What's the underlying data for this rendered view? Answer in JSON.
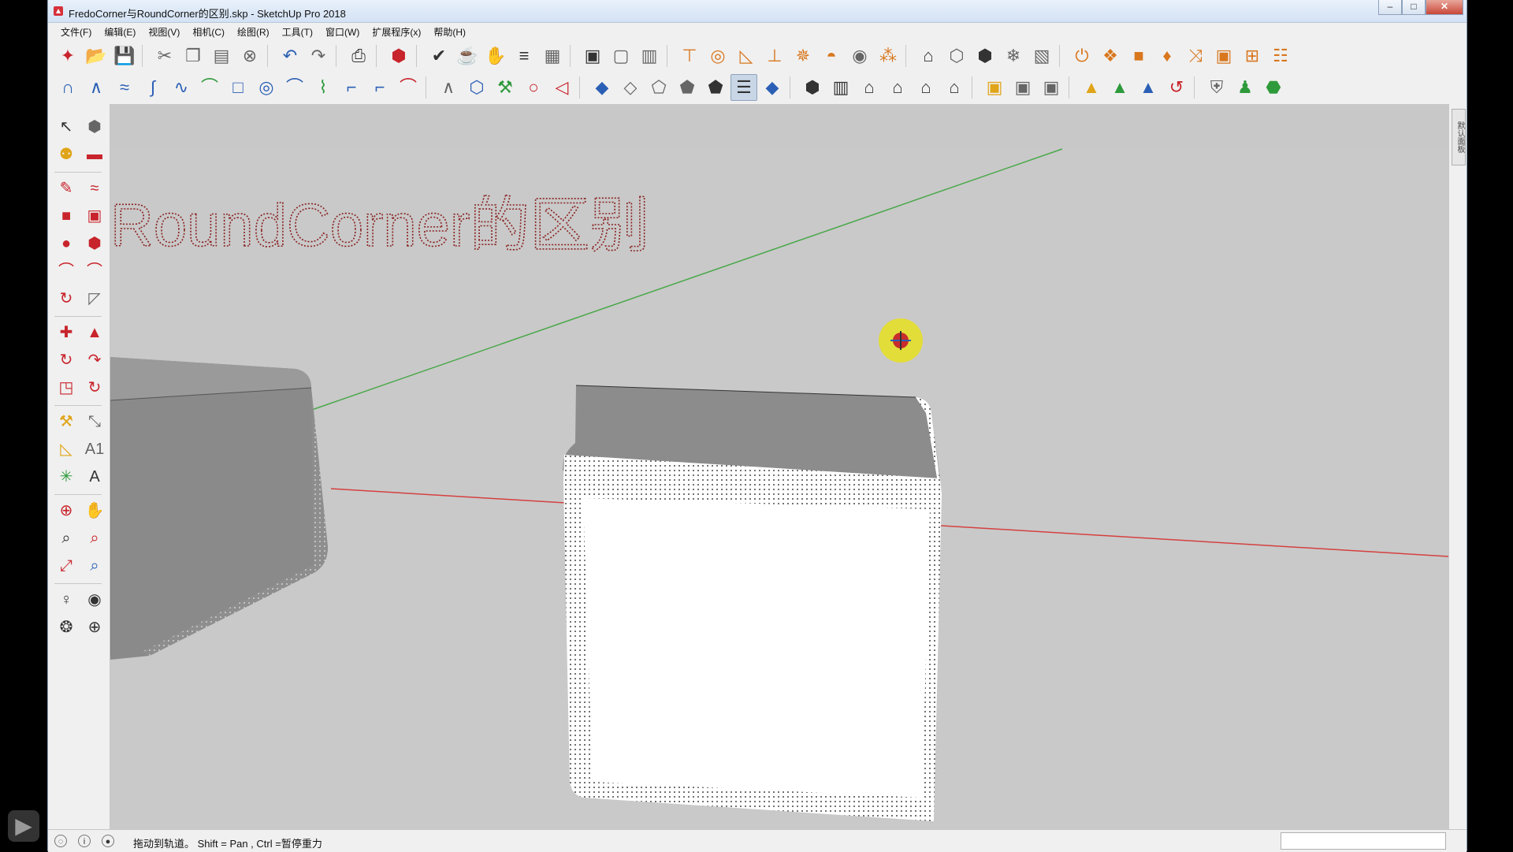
{
  "window": {
    "title": "FredoCorner与RoundCorner的区别.skp - SketchUp Pro 2018",
    "controls": {
      "minimize": "–",
      "maximize": "□",
      "close": "✕"
    }
  },
  "menu": [
    "文件(F)",
    "编辑(E)",
    "视图(V)",
    "相机(C)",
    "绘图(R)",
    "工具(T)",
    "窗口(W)",
    "扩展程序(x)",
    "帮助(H)"
  ],
  "toolbar_row1": [
    {
      "name": "new-model-icon",
      "glyph": "✦",
      "color": "red"
    },
    {
      "name": "open-folder-icon",
      "glyph": "📂",
      "color": "dark"
    },
    {
      "name": "save-icon",
      "glyph": "💾",
      "color": "blue"
    },
    {
      "sep": true
    },
    {
      "name": "cut-icon",
      "glyph": "✂",
      "color": "gray"
    },
    {
      "name": "copy-icon",
      "glyph": "❐",
      "color": "gray"
    },
    {
      "name": "paste-icon",
      "glyph": "▤",
      "color": "gray"
    },
    {
      "name": "erase-icon",
      "glyph": "⊗",
      "color": "gray"
    },
    {
      "sep": true
    },
    {
      "name": "undo-icon",
      "glyph": "↶",
      "color": "blue"
    },
    {
      "name": "redo-icon",
      "glyph": "↷",
      "color": "gray"
    },
    {
      "sep": true
    },
    {
      "name": "print-icon",
      "glyph": "⎙",
      "color": "dark"
    },
    {
      "sep": true
    },
    {
      "name": "model-info-icon",
      "glyph": "⬢",
      "color": "red"
    },
    {
      "sep": true
    },
    {
      "name": "validity-check-icon",
      "glyph": "✔",
      "color": "dark"
    },
    {
      "name": "teapot-icon",
      "glyph": "☕",
      "color": "dark"
    },
    {
      "name": "teapot-hand-icon",
      "glyph": "✋",
      "color": "dark"
    },
    {
      "name": "align-icon",
      "glyph": "≡",
      "color": "dark"
    },
    {
      "name": "layout-icon",
      "glyph": "▦",
      "color": "gray"
    },
    {
      "sep": true
    },
    {
      "name": "window-icon",
      "glyph": "▣",
      "color": "dark"
    },
    {
      "name": "window2-icon",
      "glyph": "▢",
      "color": "gray"
    },
    {
      "name": "window3-icon",
      "glyph": "▥",
      "color": "gray"
    },
    {
      "sep": true
    },
    {
      "name": "extension1-icon",
      "glyph": "⊤",
      "color": "orange"
    },
    {
      "name": "extension2-icon",
      "glyph": "◎",
      "color": "orange"
    },
    {
      "name": "extension3-icon",
      "glyph": "◺",
      "color": "orange"
    },
    {
      "name": "extension4-icon",
      "glyph": "⊥",
      "color": "orange"
    },
    {
      "name": "extension5-icon",
      "glyph": "✵",
      "color": "orange"
    },
    {
      "name": "extension6-icon",
      "glyph": "◓",
      "color": "orange"
    },
    {
      "name": "extension7-icon",
      "glyph": "◉",
      "color": "gray"
    },
    {
      "name": "extension8-icon",
      "glyph": "⁂",
      "color": "orange"
    },
    {
      "sep": true
    },
    {
      "name": "extension9-icon",
      "glyph": "⌂",
      "color": "dark"
    },
    {
      "name": "extension10-icon",
      "glyph": "⬡",
      "color": "gray"
    },
    {
      "name": "extension11-icon",
      "glyph": "⬢",
      "color": "dark"
    },
    {
      "name": "extension12-icon",
      "glyph": "❄",
      "color": "gray"
    },
    {
      "name": "extension13-icon",
      "glyph": "▧",
      "color": "gray"
    },
    {
      "sep": true
    },
    {
      "name": "power-icon",
      "glyph": "⏻",
      "color": "orange"
    },
    {
      "name": "extension14-icon",
      "glyph": "❖",
      "color": "orange"
    },
    {
      "name": "folder-orange-icon",
      "glyph": "■",
      "color": "orange"
    },
    {
      "name": "bin-icon",
      "glyph": "♦",
      "color": "orange"
    },
    {
      "name": "shuffle-icon",
      "glyph": "⤨",
      "color": "orange"
    },
    {
      "name": "frame-icon",
      "glyph": "▣",
      "color": "orange"
    },
    {
      "name": "add-frame-icon",
      "glyph": "⊞",
      "color": "orange"
    },
    {
      "name": "comment-icon",
      "glyph": "☷",
      "color": "orange"
    }
  ],
  "toolbar_row2": [
    {
      "name": "bezier-icon",
      "glyph": "∩",
      "color": "blue"
    },
    {
      "name": "polyline-icon",
      "glyph": "∧",
      "color": "blue"
    },
    {
      "name": "freehand-icon",
      "glyph": "≈",
      "color": "blue"
    },
    {
      "name": "spline-icon",
      "glyph": "∫",
      "color": "blue"
    },
    {
      "name": "curve-icon",
      "glyph": "∿",
      "color": "blue"
    },
    {
      "name": "arc-green-icon",
      "glyph": "⌒",
      "color": "green"
    },
    {
      "name": "rectangle-icon",
      "glyph": "□",
      "color": "blue"
    },
    {
      "name": "spiral-icon",
      "glyph": "◎",
      "color": "blue"
    },
    {
      "name": "arc-icon",
      "glyph": "⌒",
      "color": "blue"
    },
    {
      "name": "zigzag-icon",
      "glyph": "⌇",
      "color": "green"
    },
    {
      "name": "hook-icon",
      "glyph": "⌐",
      "color": "blue"
    },
    {
      "name": "hook2-icon",
      "glyph": "⌐",
      "color": "blue"
    },
    {
      "name": "arc-red-icon",
      "glyph": "⌒",
      "color": "red"
    },
    {
      "sep": true
    },
    {
      "name": "line-icon",
      "glyph": "∧",
      "color": "gray"
    },
    {
      "name": "polygon-icon",
      "glyph": "⬡",
      "color": "blue"
    },
    {
      "name": "wrench-icon",
      "glyph": "⚒",
      "color": "green"
    },
    {
      "name": "circle-icon",
      "glyph": "○",
      "color": "red"
    },
    {
      "name": "cone-icon",
      "glyph": "◁",
      "color": "red"
    },
    {
      "sep": true
    },
    {
      "name": "style-xray-icon",
      "glyph": "◆",
      "color": "blue"
    },
    {
      "name": "style-wire-icon",
      "glyph": "◇",
      "color": "gray"
    },
    {
      "name": "style-hidden-icon",
      "glyph": "⬠",
      "color": "gray"
    },
    {
      "name": "style-shaded-icon",
      "glyph": "⬟",
      "color": "gray"
    },
    {
      "name": "style-shaded-tex-icon",
      "glyph": "⬟",
      "color": "dark"
    },
    {
      "name": "style-mono-icon",
      "glyph": "☰",
      "color": "dark",
      "selected": true
    },
    {
      "name": "style-color-icon",
      "glyph": "◆",
      "color": "blue"
    },
    {
      "sep": true
    },
    {
      "name": "iso-view-icon",
      "glyph": "⬢",
      "color": "dark"
    },
    {
      "name": "top-view-icon",
      "glyph": "▥",
      "color": "dark"
    },
    {
      "name": "front-view-icon",
      "glyph": "⌂",
      "color": "dark"
    },
    {
      "name": "right-view-icon",
      "glyph": "⌂",
      "color": "dark"
    },
    {
      "name": "back-view-icon",
      "glyph": "⌂",
      "color": "dark"
    },
    {
      "name": "left-view-icon",
      "glyph": "⌂",
      "color": "dark"
    },
    {
      "sep": true
    },
    {
      "name": "component-icon",
      "glyph": "▣",
      "color": "gold"
    },
    {
      "name": "component2-icon",
      "glyph": "▣",
      "color": "gray"
    },
    {
      "name": "component3-icon",
      "glyph": "▣",
      "color": "gray"
    },
    {
      "sep": true
    },
    {
      "name": "warehouse-icon",
      "glyph": "▲",
      "color": "gold"
    },
    {
      "name": "warehouse-green-icon",
      "glyph": "▲",
      "color": "green"
    },
    {
      "name": "warehouse-blue-icon",
      "glyph": "▲",
      "color": "blue"
    },
    {
      "name": "warehouse-red-icon",
      "glyph": "↺",
      "color": "red"
    },
    {
      "sep": true
    },
    {
      "name": "shield-icon",
      "glyph": "⛨",
      "color": "gray"
    },
    {
      "name": "person-icon",
      "glyph": "♟",
      "color": "green"
    },
    {
      "name": "sandbox-icon",
      "glyph": "⬣",
      "color": "green"
    }
  ],
  "left_tools": [
    [
      {
        "name": "select-tool-icon",
        "glyph": "↖",
        "color": "dark"
      },
      {
        "name": "component-tool-icon",
        "glyph": "⬢",
        "color": "gray"
      }
    ],
    [
      {
        "name": "paint-bucket-icon",
        "glyph": "⚉",
        "color": "gold"
      },
      {
        "name": "eraser-icon",
        "glyph": "▬",
        "color": "red"
      }
    ],
    "sep",
    [
      {
        "name": "pencil-icon",
        "glyph": "✎",
        "color": "red"
      },
      {
        "name": "freehand-tool-icon",
        "glyph": "≈",
        "color": "red"
      }
    ],
    [
      {
        "name": "rectangle-tool-icon",
        "glyph": "■",
        "color": "red"
      },
      {
        "name": "rotated-rect-icon",
        "glyph": "▣",
        "color": "red"
      }
    ],
    [
      {
        "name": "circle-tool-icon",
        "glyph": "●",
        "color": "red"
      },
      {
        "name": "polygon-tool-icon",
        "glyph": "⬢",
        "color": "red"
      }
    ],
    [
      {
        "name": "arc-tool-icon",
        "glyph": "⌒",
        "color": "red"
      },
      {
        "name": "2pt-arc-icon",
        "glyph": "⌒",
        "color": "red"
      }
    ],
    [
      {
        "name": "3pt-arc-icon",
        "glyph": "↻",
        "color": "red"
      },
      {
        "name": "pie-icon",
        "glyph": "◸",
        "color": "gray"
      }
    ],
    "sep",
    [
      {
        "name": "move-tool-icon",
        "glyph": "✚",
        "color": "red"
      },
      {
        "name": "push-pull-icon",
        "glyph": "▲",
        "color": "red"
      }
    ],
    [
      {
        "name": "rotate-tool-icon",
        "glyph": "↻",
        "color": "red"
      },
      {
        "name": "follow-me-icon",
        "glyph": "↷",
        "color": "red"
      }
    ],
    [
      {
        "name": "scale-tool-icon",
        "glyph": "◳",
        "color": "red"
      },
      {
        "name": "offset-icon",
        "glyph": "↻",
        "color": "red"
      }
    ],
    "sep",
    [
      {
        "name": "tape-measure-icon",
        "glyph": "⚒",
        "color": "gold"
      },
      {
        "name": "dimension-icon",
        "glyph": "⤡",
        "color": "gray"
      }
    ],
    [
      {
        "name": "protractor-icon",
        "glyph": "◺",
        "color": "gold"
      },
      {
        "name": "text-tool-icon",
        "glyph": "A1",
        "color": "gray"
      }
    ],
    [
      {
        "name": "axes-tool-icon",
        "glyph": "✳",
        "color": "green"
      },
      {
        "name": "3d-text-icon",
        "glyph": "A",
        "color": "dark"
      }
    ],
    "sep",
    [
      {
        "name": "orbit-tool-icon",
        "glyph": "⊕",
        "color": "red"
      },
      {
        "name": "pan-tool-icon",
        "glyph": "✋",
        "color": "gold"
      }
    ],
    [
      {
        "name": "zoom-tool-icon",
        "glyph": "⌕",
        "color": "dark"
      },
      {
        "name": "zoom-window-icon",
        "glyph": "⌕",
        "color": "red"
      }
    ],
    [
      {
        "name": "zoom-extents-icon",
        "glyph": "⤢",
        "color": "red"
      },
      {
        "name": "previous-view-icon",
        "glyph": "⌕",
        "color": "blue"
      }
    ],
    "sep",
    [
      {
        "name": "position-camera-icon",
        "glyph": "♀",
        "color": "dark"
      },
      {
        "name": "look-around-icon",
        "glyph": "◉",
        "color": "dark"
      }
    ],
    [
      {
        "name": "walk-icon",
        "glyph": "❂",
        "color": "dark"
      },
      {
        "name": "section-plane-icon",
        "glyph": "⊕",
        "color": "dark"
      }
    ]
  ],
  "tray": {
    "label": "默认面板"
  },
  "viewport": {
    "heading": "RoundCorner的区别",
    "colors": {
      "background": "#c9c9c9",
      "green_axis": "#4aa84a",
      "red_axis": "#d54040",
      "heading": "#8a2020",
      "cursor_halo": "#e8e020"
    }
  },
  "status": {
    "text": "拖动到轨道。 Shift = Pan , Ctrl =暂停重力"
  },
  "logo": {
    "glyph": "▶"
  }
}
